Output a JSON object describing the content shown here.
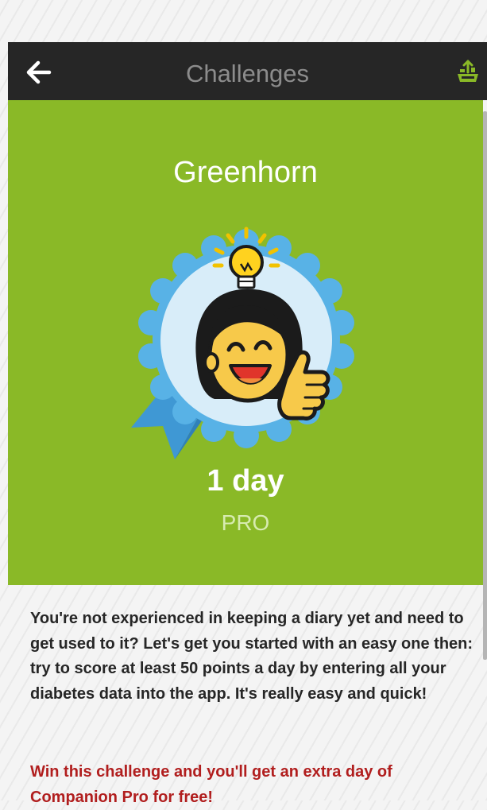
{
  "header": {
    "title": "Challenges",
    "back_icon": "arrow-left-icon",
    "sync_icon": "sync-device-icon",
    "sync_color": "#8ab927"
  },
  "challenge": {
    "name": "Greenhorn",
    "reward_value": "1 day",
    "reward_type": "PRO",
    "badge_icon": "lightbulb-thumbs-up-badge-icon",
    "description": "You're not experienced in keeping a diary yet and need to get used to it? Let's get you started with an easy one then: try to score at least 50 points a day by entering all your diabetes data into the app. It's really easy and quick!",
    "reward_note": "Win this challenge and you'll get an extra day of Companion Pro for free!"
  },
  "colors": {
    "hero_bg": "#8ab927",
    "app_bar_bg": "#262626",
    "badge_blue": "#4aa9e0",
    "badge_light": "#d6ecf8",
    "reward_text": "#b11e1e"
  }
}
